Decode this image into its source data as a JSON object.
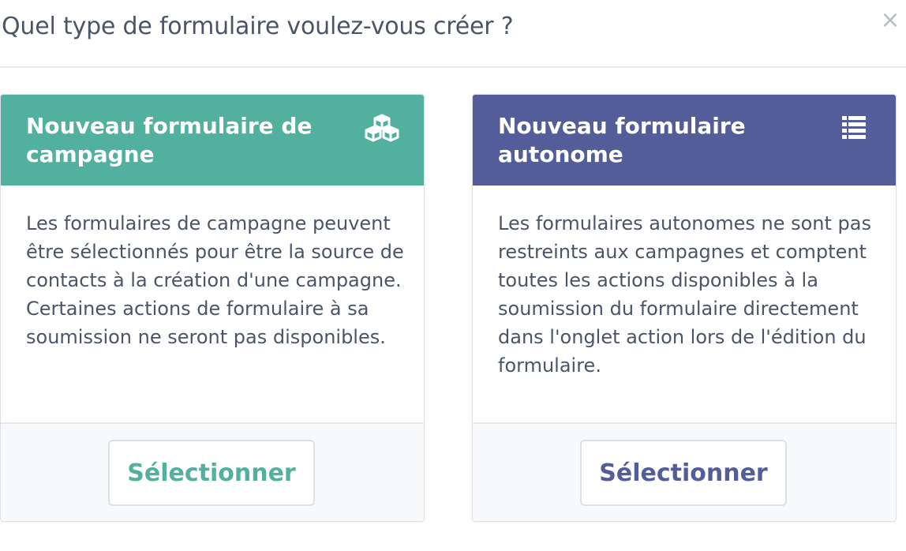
{
  "modal": {
    "title": "Quel type de formulaire voulez-vous créer ?",
    "close_label": "×"
  },
  "cards": [
    {
      "title": "Nouveau formulaire de campagne",
      "icon": "cubes-icon",
      "accent_color": "#52b09e",
      "description": "Les formulaires de campagne peuvent être sélectionnés pour être la source de contacts à la création d'une campagne. Certaines actions de formulaire à sa soumission ne seront pas disponibles.",
      "button_label": "Sélectionner"
    },
    {
      "title": "Nouveau formulaire autonome",
      "icon": "list-icon",
      "accent_color": "#525d9a",
      "description": "Les formulaires autonomes ne sont pas restreints aux campagnes et comptent toutes les actions disponibles à la soumission du formulaire directement dans l'onglet action lors de l'édition du formulaire.",
      "button_label": "Sélectionner"
    }
  ]
}
